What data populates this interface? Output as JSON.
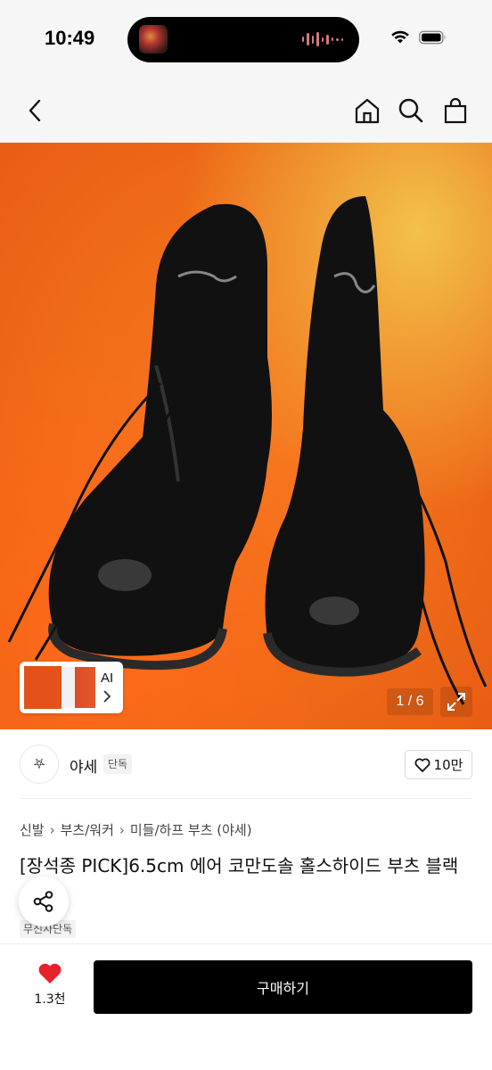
{
  "status_bar": {
    "time": "10:49"
  },
  "header": {
    "back_icon": "chevron-left-icon",
    "home_icon": "home-icon",
    "search_icon": "search-icon",
    "cart_icon": "shopping-bag-icon"
  },
  "hero": {
    "thumbnail_label": "AI",
    "page_counter": "1 / 6",
    "background_color": "#ef6a1a"
  },
  "brand": {
    "logo_glyph": "⛧",
    "name": "야세",
    "badge": "단독",
    "like_count": "10만"
  },
  "breadcrumb": [
    "신발",
    "부츠/워커",
    "미들/하프 부츠 (야세)"
  ],
  "product": {
    "title": "[장석종 PICK]6.5cm 에어 코만도솔 홀스하이드 부츠 블랙",
    "tag": "무신사단독"
  },
  "bottom_bar": {
    "wish_count": "1.3천",
    "buy_label": "구매하기",
    "heart_color": "#e8212c"
  }
}
